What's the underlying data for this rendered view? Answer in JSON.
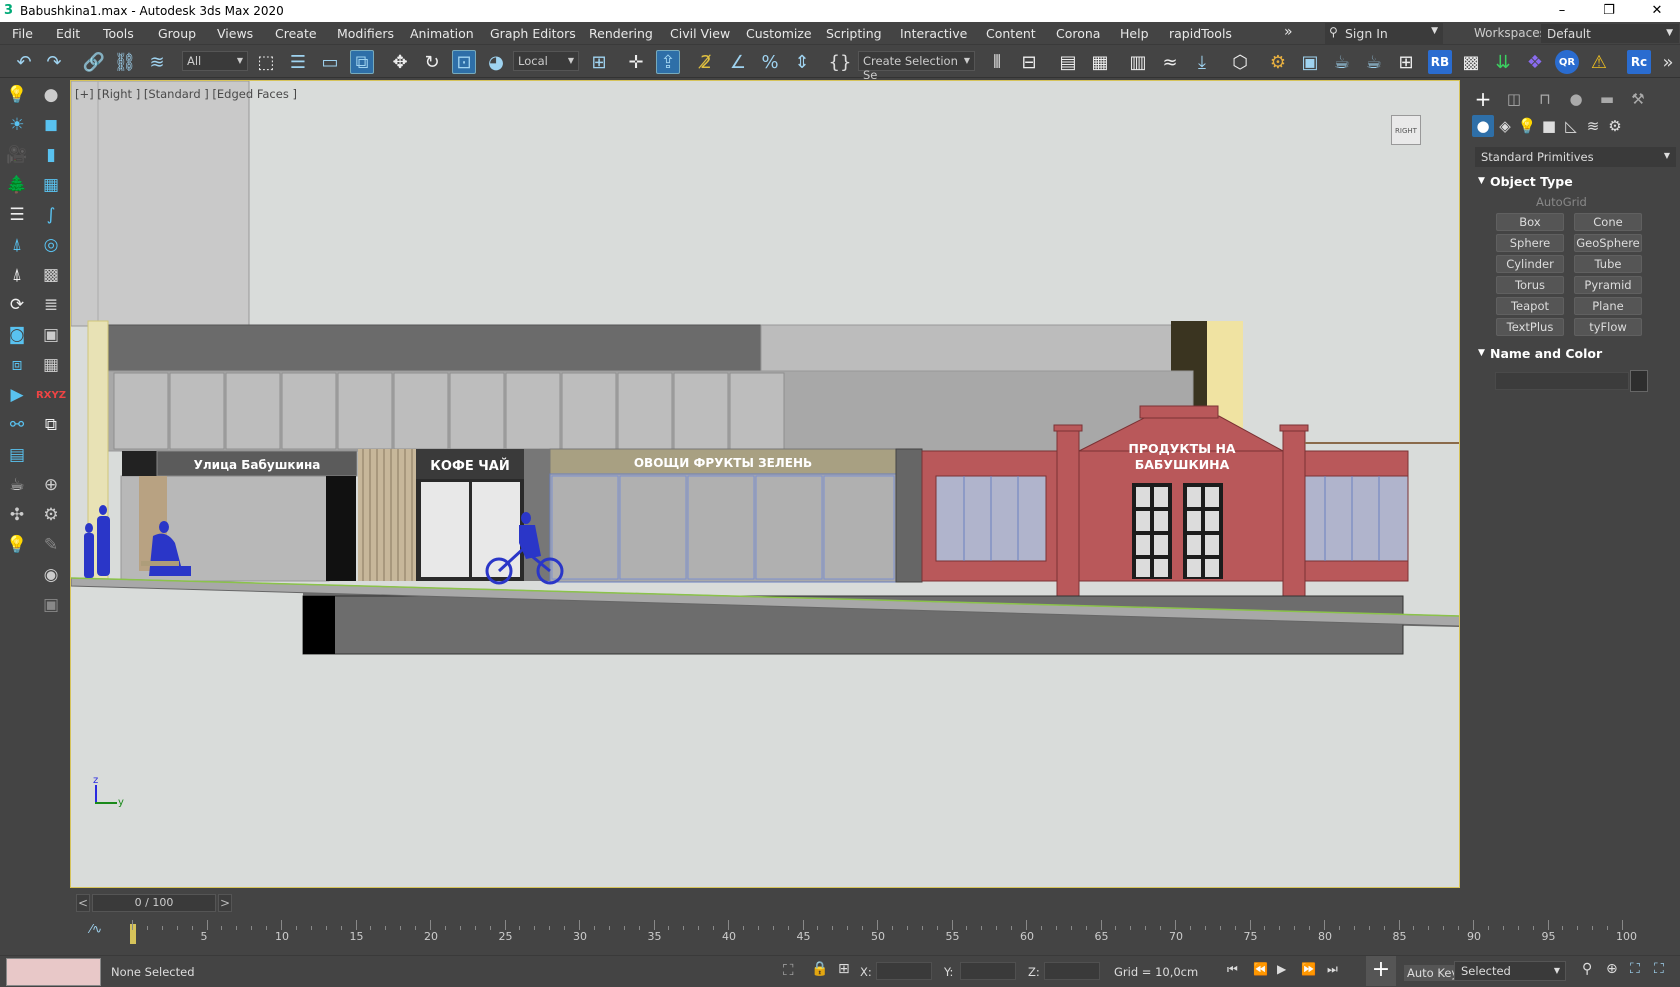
{
  "window": {
    "title": "Babushkina1.max - Autodesk 3ds Max 2020",
    "minimize": "–",
    "restore": "❐",
    "close": "✕"
  },
  "menu": [
    "File",
    "Edit",
    "Tools",
    "Group",
    "Views",
    "Create",
    "Modifiers",
    "Animation",
    "Graph Editors",
    "Rendering",
    "Civil View",
    "Customize",
    "Scripting",
    "Interactive",
    "Content",
    "Corona",
    "Help",
    "rapidTools"
  ],
  "menu_more": "»",
  "signin": {
    "label": "Sign In"
  },
  "workspaces": {
    "label": "Workspaces:",
    "value": "Default"
  },
  "toolbar": {
    "filter_value": "All",
    "coord_system": "Local",
    "named_selection": "Create Selection Se",
    "rb_badge": "RB",
    "qr_badge": "QR",
    "rc_badge": "Rc"
  },
  "viewport": {
    "label": "[+] [Right ] [Standard ] [Edged Faces ]",
    "viewcube_label": "RIGHT",
    "signs": {
      "street": "Улица Бабушкина",
      "coffee": "КОФЕ ЧАЙ",
      "vegetables": "ОВОЩИ ФРУКТЫ ЗЕЛЕНЬ",
      "store_line1": "ПРОДУКТЫ НА",
      "store_line2": "БАБУШКИНА"
    },
    "axis": {
      "z": "z",
      "y": "y"
    }
  },
  "command_panel": {
    "dropdown": "Standard Primitives",
    "object_type": {
      "title": "Object Type",
      "autogrid": "AutoGrid",
      "buttons": [
        "Box",
        "Cone",
        "Sphere",
        "GeoSphere",
        "Cylinder",
        "Tube",
        "Torus",
        "Pyramid",
        "Teapot",
        "Plane",
        "TextPlus",
        "tyFlow"
      ]
    },
    "name_and_color": {
      "title": "Name and Color",
      "name_value": ""
    }
  },
  "timeline": {
    "frame_display": "0 / 100",
    "prev": "<",
    "next": ">",
    "ticks": [
      "5",
      "10",
      "15",
      "20",
      "25",
      "30",
      "35",
      "40",
      "45",
      "50",
      "55",
      "60",
      "65",
      "70",
      "75",
      "80",
      "85",
      "90",
      "95",
      "100"
    ]
  },
  "status": {
    "selection": "None Selected",
    "x_label": "X:",
    "y_label": "Y:",
    "z_label": "Z:",
    "grid": "Grid = 10,0cm",
    "auto_key": "Auto Key",
    "key_mode": "Selected"
  }
}
